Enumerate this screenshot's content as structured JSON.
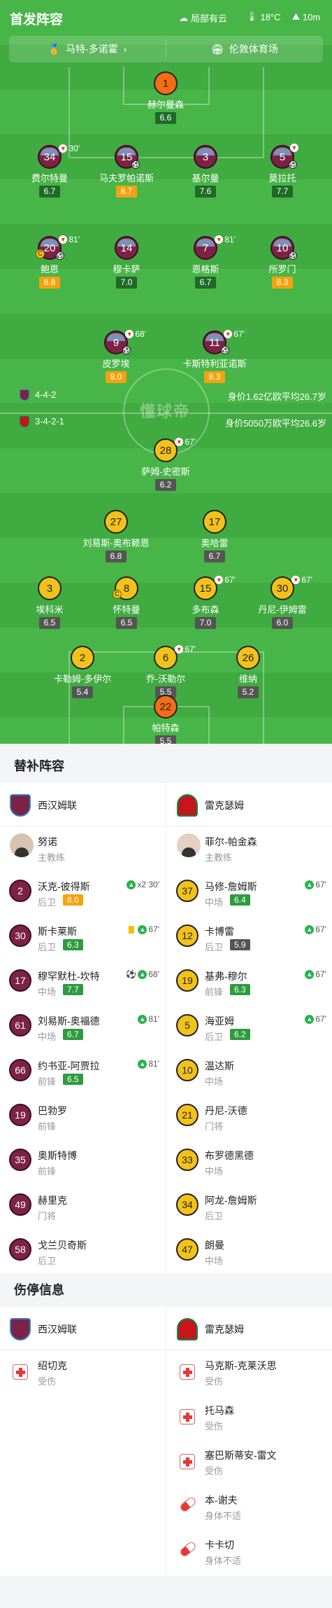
{
  "header": {
    "title": "首发阵容",
    "weather": "局部有云",
    "temperature": "18°C",
    "wind": "10m"
  },
  "info": {
    "referee": "马特-多诺霍",
    "venue": "伦敦体育场"
  },
  "home_team": {
    "formation": "4-4-2",
    "value": "身价1.62亿欧",
    "avg_age": "平均26.7岁"
  },
  "away_team": {
    "formation": "3-4-2-1",
    "value": "身价5050万欧",
    "avg_age": "平均26.6岁"
  },
  "watermark": "懂球帝",
  "home_players": [
    {
      "num": "1",
      "name": "赫尔曼森",
      "rating": "6.6",
      "sub": ""
    },
    {
      "num": "34",
      "name": "费尔特曼",
      "rating": "6.7",
      "sub": "30'"
    },
    {
      "num": "15",
      "name": "马夫罗帕诺斯",
      "rating": "8.7",
      "sub": ""
    },
    {
      "num": "3",
      "name": "基尔曼",
      "rating": "7.6",
      "sub": ""
    },
    {
      "num": "5",
      "name": "莫拉托",
      "rating": "7.7",
      "sub": ""
    },
    {
      "num": "20",
      "name": "鲍恩",
      "rating": "8.8",
      "sub": "81'"
    },
    {
      "num": "14",
      "name": "穆卡萨",
      "rating": "7.0",
      "sub": ""
    },
    {
      "num": "7",
      "name": "恩格斯",
      "rating": "6.7",
      "sub": "81'"
    },
    {
      "num": "10",
      "name": "所罗门",
      "rating": "8.3",
      "sub": ""
    },
    {
      "num": "9",
      "name": "皮罗埃",
      "rating": "8.0",
      "sub": "68'"
    },
    {
      "num": "11",
      "name": "卡斯特利亚诺斯",
      "rating": "8.3",
      "sub": "67'"
    }
  ],
  "away_players": [
    {
      "num": "28",
      "name": "萨姆-史密斯",
      "rating": "6.2",
      "sub": "67'"
    },
    {
      "num": "27",
      "name": "刘易斯-奥布赖恩",
      "rating": "6.8",
      "sub": ""
    },
    {
      "num": "17",
      "name": "奥哈雷",
      "rating": "6.7",
      "sub": ""
    },
    {
      "num": "3",
      "name": "埃科米",
      "rating": "6.5",
      "sub": ""
    },
    {
      "num": "8",
      "name": "怀特曼",
      "rating": "6.5",
      "sub": ""
    },
    {
      "num": "15",
      "name": "多布森",
      "rating": "7.0",
      "sub": "67'"
    },
    {
      "num": "30",
      "name": "丹尼-伊姆雷",
      "rating": "6.0",
      "sub": "67'"
    },
    {
      "num": "2",
      "name": "卡勒姆-多伊尔",
      "rating": "5.4",
      "sub": ""
    },
    {
      "num": "6",
      "name": "乔-沃勒尔",
      "rating": "5.5",
      "sub": "67'"
    },
    {
      "num": "26",
      "name": "维纳",
      "rating": "5.2",
      "sub": ""
    },
    {
      "num": "22",
      "name": "帕特森",
      "rating": "5.5",
      "sub": ""
    }
  ],
  "subs_section": {
    "title": "替补阵容",
    "home_name": "西汉姆联",
    "away_name": "雷克瑟姆",
    "home_coach": {
      "name": "努诺",
      "role": "主教练"
    },
    "away_coach": {
      "name": "菲尔-帕金森",
      "role": "主教练"
    },
    "home": [
      {
        "num": "2",
        "name": "沃克-彼得斯",
        "pos": "后卫",
        "rating": "8.0",
        "event": "x2 30'"
      },
      {
        "num": "30",
        "name": "斯卡莱斯",
        "pos": "后卫",
        "rating": "6.3",
        "event": "67'"
      },
      {
        "num": "17",
        "name": "穆罕默杜-坎特",
        "pos": "中场",
        "rating": "7.7",
        "event": "68'"
      },
      {
        "num": "61",
        "name": "刘易斯-奥福德",
        "pos": "中场",
        "rating": "6.7",
        "event": "81'"
      },
      {
        "num": "66",
        "name": "约书亚-阿贾拉",
        "pos": "前锋",
        "rating": "6.5",
        "event": "81'"
      },
      {
        "num": "19",
        "name": "巴勃罗",
        "pos": "前锋",
        "rating": "",
        "event": ""
      },
      {
        "num": "35",
        "name": "奥斯特博",
        "pos": "前锋",
        "rating": "",
        "event": ""
      },
      {
        "num": "49",
        "name": "赫里克",
        "pos": "门将",
        "rating": "",
        "event": ""
      },
      {
        "num": "58",
        "name": "戈兰贝奇斯",
        "pos": "后卫",
        "rating": "",
        "event": ""
      }
    ],
    "away": [
      {
        "num": "37",
        "name": "马修-詹姆斯",
        "pos": "中场",
        "rating": "6.4",
        "event": "67'"
      },
      {
        "num": "12",
        "name": "卡博雷",
        "pos": "后卫",
        "rating": "5.9",
        "event": "67'"
      },
      {
        "num": "19",
        "name": "基弗-穆尔",
        "pos": "前锋",
        "rating": "6.3",
        "event": "67'"
      },
      {
        "num": "5",
        "name": "海亚姆",
        "pos": "后卫",
        "rating": "6.2",
        "event": "67'"
      },
      {
        "num": "10",
        "name": "温达斯",
        "pos": "中场",
        "rating": "",
        "event": ""
      },
      {
        "num": "21",
        "name": "丹尼-沃德",
        "pos": "门将",
        "rating": "",
        "event": ""
      },
      {
        "num": "33",
        "name": "布罗德黑德",
        "pos": "中场",
        "rating": "",
        "event": ""
      },
      {
        "num": "34",
        "name": "阿龙-詹姆斯",
        "pos": "后卫",
        "rating": "",
        "event": ""
      },
      {
        "num": "47",
        "name": "朗曼",
        "pos": "中场",
        "rating": "",
        "event": ""
      }
    ]
  },
  "injury_section": {
    "title": "伤停信息",
    "home_name": "西汉姆联",
    "away_name": "雷克瑟姆",
    "home": [
      {
        "name": "绍切克",
        "status": "受伤",
        "icon": "injury-icon"
      }
    ],
    "away": [
      {
        "name": "马克斯-克莱沃思",
        "status": "受伤",
        "icon": "injury-icon"
      },
      {
        "name": "托马森",
        "status": "受伤",
        "icon": "injury-icon"
      },
      {
        "name": "塞巴斯蒂安-雷文",
        "status": "受伤",
        "icon": "injury-icon"
      },
      {
        "name": "本-谢夫",
        "status": "身体不适",
        "icon": "pill-icon"
      },
      {
        "name": "卡卡切",
        "status": "身体不适",
        "icon": "pill-icon"
      }
    ]
  },
  "colors": {
    "pitch": "#43af43",
    "home_shirt": "#7c2345",
    "away_shirt": "#f2c21b",
    "rating_green": "#2e9b3e",
    "rating_orange": "#f4a20d",
    "rating_gray": "#555555"
  }
}
